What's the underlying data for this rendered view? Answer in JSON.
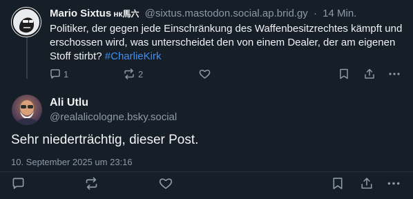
{
  "parent_post": {
    "author_name": "Mario Sixtus",
    "author_badge": "нк馬六",
    "handle": "@sixtus.mastodon.social.ap.brid.gy",
    "separator": "·",
    "time": "14 Min.",
    "text": "Politiker, der gegen jede Einschränkung des Waffenbesitzrechtes kämpft und erschossen wird, was unterscheidet den von einem Dealer, der am eigenen Stoff stirbt? ",
    "hashtag": "#CharlieKirk",
    "reply_count": "1",
    "repost_count": "2"
  },
  "focused_post": {
    "author_name": "Ali Utlu",
    "handle": "@realalicologne.bsky.social",
    "text": "Sehr niederträchtig, dieser Post.",
    "date": "10. September 2025 um 23:16"
  },
  "icons": {
    "reply": "speech-bubble-icon",
    "repost": "repost-arrows-icon",
    "like": "heart-icon",
    "bookmark": "bookmark-icon",
    "share": "share-icon",
    "more": "more-horizontal-icon"
  },
  "colors": {
    "background": "#161e27",
    "text": "#f1f3f5",
    "muted": "#8d9aa8",
    "link": "#3e8ff5",
    "thread_line": "#2e4052"
  }
}
